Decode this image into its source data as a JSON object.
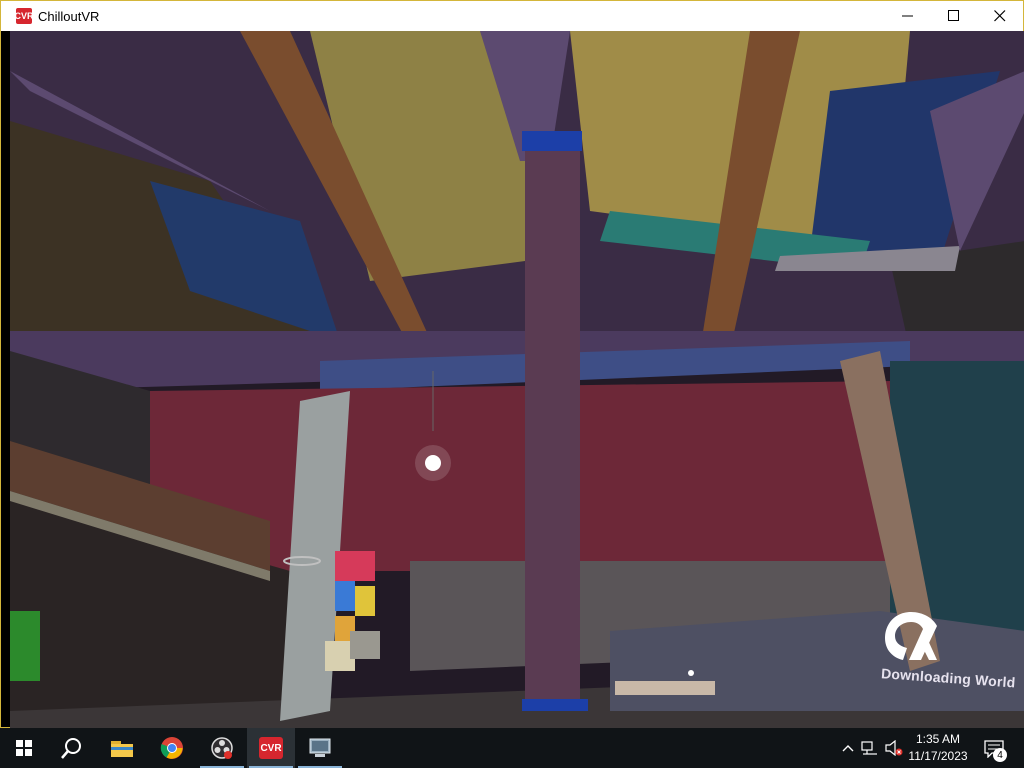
{
  "window": {
    "title": "ChilloutVR",
    "app_icon_text": "CVR",
    "accent_border": "#d4b63a"
  },
  "game": {
    "status_text": "Downloading World"
  },
  "taskbar": {
    "apps": [
      {
        "name": "start",
        "icon": "windows-logo-icon"
      },
      {
        "name": "search",
        "icon": "search-icon"
      },
      {
        "name": "file-explorer",
        "icon": "folder-icon"
      },
      {
        "name": "chrome",
        "icon": "chrome-icon"
      },
      {
        "name": "obs",
        "icon": "obs-icon"
      },
      {
        "name": "chilloutvr",
        "icon": "chilloutvr-icon"
      },
      {
        "name": "network-app",
        "icon": "network-drive-icon"
      }
    ],
    "clock": {
      "time": "1:35 AM",
      "date": "11/17/2023"
    },
    "notification_count": "4"
  }
}
